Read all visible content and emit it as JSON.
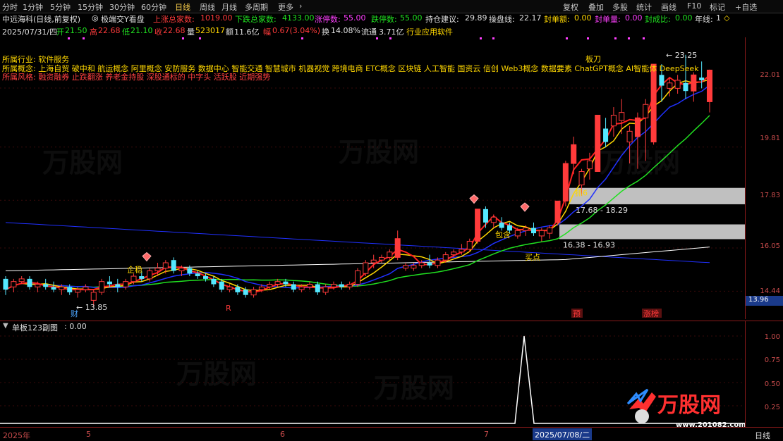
{
  "toolbar": {
    "periods": [
      "分时",
      "1分钟",
      "5分钟",
      "15分钟",
      "30分钟",
      "60分钟",
      "日线",
      "周线",
      "月线",
      "多周期",
      "更多"
    ],
    "active_period": "日线",
    "right_buttons": [
      "复权",
      "叠加",
      "多股",
      "统计",
      "画线",
      "F10",
      "标记",
      "+自选"
    ]
  },
  "info": {
    "stock_name": "中远海科(日线,前复权)",
    "panel_name": "极端交Y看盘",
    "up_total_label": "上涨总家数:",
    "up_total": "1019.00",
    "down_total_label": "下跌总家数:",
    "down_total": "4133.00",
    "limit_up_label": "涨停数:",
    "limit_up": "55.00",
    "limit_down_label": "跌停数:",
    "limit_down": "55.00",
    "position_label": "持仓建议:",
    "position": "29.89",
    "control_label": "操盘线:",
    "control": "22.17",
    "seal_amount_label": "封单额:",
    "seal_amount": "0.00",
    "seal_volume_label": "封单量:",
    "seal_volume": "0.00",
    "seal_ratio_label": "封成比:",
    "seal_ratio": "0.00",
    "year_line_label": "年线:",
    "year_line": "1"
  },
  "ohlc": {
    "date": "2025/07/31/四",
    "open_label": "开",
    "open": "21.50",
    "high_label": "高",
    "high": "22.68",
    "low_label": "低",
    "low": "21.10",
    "close_label": "收",
    "close": "22.68",
    "volume_label": "量",
    "volume": "523017",
    "amount_label": "额",
    "amount": "11.6亿",
    "change_label": "幅",
    "change": "0.67(3.04%)",
    "turnover_label": "换",
    "turnover": "14.08%",
    "float_label": "流通",
    "float": "3.71亿",
    "industry_tag": "行业应用软件"
  },
  "concepts": {
    "industry_label": "所属行业:",
    "industry": "软件服务",
    "concept_label": "所属概念:",
    "concept": "上海自贸 破中和 航运概念 阿里概念 安防服务 数据中心 智能交通 智慧城市 机器视觉 跨境电商 ETC概念 区块链 人工智能 国资云 信创 Web3概念 数据要素 ChatGPT概念 AI智能体 DeepSeek",
    "style_label": "所属风格:",
    "style": "融资融券 止跌翻涨 养老金持股 深股通标的 中字头 活跃股 近期强势"
  },
  "chart_data": {
    "type": "candlestick",
    "yticks": [
      "22.01",
      "19.81",
      "17.83",
      "16.05",
      "14.44"
    ],
    "ylim": [
      13.4,
      23.9
    ],
    "current_price_tag": "13.96",
    "candles": [
      {
        "o": 14.9,
        "h": 15.0,
        "l": 14.3,
        "c": 14.5
      },
      {
        "o": 14.6,
        "h": 14.9,
        "l": 14.4,
        "c": 14.8
      },
      {
        "o": 14.8,
        "h": 15.0,
        "l": 14.7,
        "c": 14.9
      },
      {
        "o": 14.9,
        "h": 15.0,
        "l": 14.5,
        "c": 14.6
      },
      {
        "o": 14.6,
        "h": 14.8,
        "l": 14.4,
        "c": 14.7
      },
      {
        "o": 14.7,
        "h": 14.9,
        "l": 14.5,
        "c": 14.6
      },
      {
        "o": 14.6,
        "h": 14.8,
        "l": 14.4,
        "c": 14.5
      },
      {
        "o": 14.5,
        "h": 14.7,
        "l": 14.3,
        "c": 14.6
      },
      {
        "o": 14.6,
        "h": 14.7,
        "l": 14.3,
        "c": 14.4
      },
      {
        "o": 14.4,
        "h": 14.6,
        "l": 14.2,
        "c": 14.5
      },
      {
        "o": 14.5,
        "h": 14.7,
        "l": 14.4,
        "c": 14.6
      },
      {
        "o": 14.1,
        "h": 14.5,
        "l": 13.85,
        "c": 14.4
      },
      {
        "o": 14.4,
        "h": 14.9,
        "l": 14.3,
        "c": 14.8
      },
      {
        "o": 14.8,
        "h": 15.0,
        "l": 14.6,
        "c": 14.7
      },
      {
        "o": 14.7,
        "h": 14.9,
        "l": 14.4,
        "c": 14.6
      },
      {
        "o": 14.6,
        "h": 14.9,
        "l": 14.5,
        "c": 14.8
      },
      {
        "o": 14.8,
        "h": 15.1,
        "l": 14.7,
        "c": 15.0
      },
      {
        "o": 15.0,
        "h": 15.2,
        "l": 14.8,
        "c": 14.9
      },
      {
        "o": 14.9,
        "h": 15.3,
        "l": 14.8,
        "c": 15.2
      },
      {
        "o": 15.2,
        "h": 15.5,
        "l": 15.0,
        "c": 15.3
      },
      {
        "o": 15.3,
        "h": 15.6,
        "l": 15.1,
        "c": 15.5
      },
      {
        "o": 15.6,
        "h": 15.7,
        "l": 15.1,
        "c": 15.2
      },
      {
        "o": 15.2,
        "h": 15.4,
        "l": 15.0,
        "c": 15.3
      },
      {
        "o": 15.3,
        "h": 15.4,
        "l": 15.0,
        "c": 15.1
      },
      {
        "o": 15.1,
        "h": 15.2,
        "l": 14.9,
        "c": 15.0
      },
      {
        "o": 15.0,
        "h": 15.1,
        "l": 14.8,
        "c": 14.9
      },
      {
        "o": 14.9,
        "h": 15.0,
        "l": 14.6,
        "c": 14.7
      },
      {
        "o": 14.8,
        "h": 14.9,
        "l": 14.4,
        "c": 14.5
      },
      {
        "o": 14.5,
        "h": 14.7,
        "l": 14.4,
        "c": 14.6
      },
      {
        "o": 14.6,
        "h": 14.7,
        "l": 14.3,
        "c": 14.4
      },
      {
        "o": 14.5,
        "h": 14.6,
        "l": 14.2,
        "c": 14.3
      },
      {
        "o": 14.3,
        "h": 14.6,
        "l": 14.2,
        "c": 14.5
      },
      {
        "o": 14.5,
        "h": 14.7,
        "l": 14.4,
        "c": 14.6
      },
      {
        "o": 14.6,
        "h": 14.8,
        "l": 14.5,
        "c": 14.7
      },
      {
        "o": 14.7,
        "h": 14.9,
        "l": 14.6,
        "c": 14.8
      },
      {
        "o": 14.8,
        "h": 14.9,
        "l": 14.6,
        "c": 14.7
      },
      {
        "o": 14.7,
        "h": 14.8,
        "l": 14.4,
        "c": 14.5
      },
      {
        "o": 14.5,
        "h": 14.7,
        "l": 14.4,
        "c": 14.6
      },
      {
        "o": 14.6,
        "h": 14.8,
        "l": 14.5,
        "c": 14.7
      },
      {
        "o": 14.7,
        "h": 14.8,
        "l": 14.3,
        "c": 14.4
      },
      {
        "o": 14.4,
        "h": 14.7,
        "l": 14.3,
        "c": 14.6
      },
      {
        "o": 14.6,
        "h": 14.8,
        "l": 14.5,
        "c": 14.7
      },
      {
        "o": 14.7,
        "h": 14.8,
        "l": 14.5,
        "c": 14.6
      },
      {
        "o": 14.6,
        "h": 14.8,
        "l": 14.5,
        "c": 14.7
      },
      {
        "o": 14.7,
        "h": 15.3,
        "l": 14.6,
        "c": 15.2
      },
      {
        "o": 15.1,
        "h": 15.6,
        "l": 15.0,
        "c": 15.5
      },
      {
        "o": 15.5,
        "h": 15.8,
        "l": 15.3,
        "c": 15.6
      },
      {
        "o": 15.6,
        "h": 15.8,
        "l": 15.5,
        "c": 15.7
      },
      {
        "o": 15.7,
        "h": 16.0,
        "l": 15.6,
        "c": 15.9
      },
      {
        "o": 15.7,
        "h": 16.7,
        "l": 15.6,
        "c": 16.4
      },
      {
        "o": 15.3,
        "h": 15.5,
        "l": 15.2,
        "c": 15.4
      },
      {
        "o": 15.3,
        "h": 15.5,
        "l": 15.2,
        "c": 15.4
      },
      {
        "o": 15.4,
        "h": 15.6,
        "l": 15.3,
        "c": 15.5
      },
      {
        "o": 15.5,
        "h": 15.8,
        "l": 15.3,
        "c": 15.4
      },
      {
        "o": 15.4,
        "h": 15.7,
        "l": 15.3,
        "c": 15.6
      },
      {
        "o": 15.6,
        "h": 15.9,
        "l": 15.5,
        "c": 15.8
      },
      {
        "o": 15.8,
        "h": 16.0,
        "l": 15.7,
        "c": 15.9
      },
      {
        "o": 15.9,
        "h": 16.2,
        "l": 15.8,
        "c": 16.0
      },
      {
        "o": 16.0,
        "h": 16.4,
        "l": 15.9,
        "c": 16.3
      },
      {
        "o": 16.3,
        "h": 17.5,
        "l": 16.2,
        "c": 17.5
      },
      {
        "o": 17.5,
        "h": 17.6,
        "l": 16.8,
        "c": 17.0
      },
      {
        "o": 17.0,
        "h": 17.3,
        "l": 16.8,
        "c": 17.2
      },
      {
        "o": 17.0,
        "h": 17.2,
        "l": 16.7,
        "c": 16.8
      },
      {
        "o": 16.9,
        "h": 17.0,
        "l": 16.6,
        "c": 16.7
      },
      {
        "o": 16.5,
        "h": 16.8,
        "l": 16.4,
        "c": 16.7
      },
      {
        "o": 16.7,
        "h": 16.9,
        "l": 16.5,
        "c": 16.8
      },
      {
        "o": 16.8,
        "h": 17.0,
        "l": 16.5,
        "c": 16.6
      },
      {
        "o": 16.5,
        "h": 16.8,
        "l": 16.3,
        "c": 16.7
      },
      {
        "o": 16.6,
        "h": 16.9,
        "l": 16.4,
        "c": 16.8
      },
      {
        "o": 17.0,
        "h": 17.8,
        "l": 16.9,
        "c": 17.8
      },
      {
        "o": 17.8,
        "h": 19.3,
        "l": 17.6,
        "c": 19.2
      },
      {
        "o": 19.2,
        "h": 20.2,
        "l": 18.8,
        "c": 19.9
      },
      {
        "o": 18.4,
        "h": 19.0,
        "l": 18.0,
        "c": 18.9
      },
      {
        "o": 19.0,
        "h": 19.6,
        "l": 18.6,
        "c": 19.3
      },
      {
        "o": 18.9,
        "h": 21.0,
        "l": 18.9,
        "c": 21.0
      },
      {
        "o": 20.5,
        "h": 20.9,
        "l": 19.8,
        "c": 20.0
      },
      {
        "o": 20.6,
        "h": 21.3,
        "l": 20.2,
        "c": 21.0
      },
      {
        "o": 20.8,
        "h": 21.6,
        "l": 20.3,
        "c": 21.1
      },
      {
        "o": 20.0,
        "h": 20.6,
        "l": 19.2,
        "c": 20.4
      },
      {
        "o": 20.2,
        "h": 21.1,
        "l": 19.0,
        "c": 20.9
      },
      {
        "o": 20.9,
        "h": 21.6,
        "l": 19.3,
        "c": 21.4
      },
      {
        "o": 20.0,
        "h": 22.9,
        "l": 19.9,
        "c": 22.9
      },
      {
        "o": 22.5,
        "h": 22.9,
        "l": 21.5,
        "c": 22.1
      },
      {
        "o": 22.0,
        "h": 22.4,
        "l": 21.7,
        "c": 22.2
      },
      {
        "o": 22.0,
        "h": 22.5,
        "l": 21.8,
        "c": 22.3
      },
      {
        "o": 22.2,
        "h": 23.25,
        "l": 21.6,
        "c": 21.9
      },
      {
        "o": 21.9,
        "h": 22.6,
        "l": 21.5,
        "c": 22.5
      },
      {
        "o": 22.4,
        "h": 23.0,
        "l": 22.0,
        "c": 22.3
      },
      {
        "o": 21.5,
        "h": 22.7,
        "l": 21.1,
        "c": 22.68
      }
    ],
    "annotations": [
      {
        "text": "13.85",
        "kind": "low"
      },
      {
        "text": "23.25",
        "kind": "high"
      },
      {
        "text": "企稳",
        "kind": "signal"
      },
      {
        "text": "包含",
        "kind": "signal"
      },
      {
        "text": "买点",
        "kind": "signal"
      },
      {
        "text": "抓6",
        "kind": "signal"
      },
      {
        "text": "板刀",
        "kind": "signal"
      },
      {
        "text": "17.68 - 18.29",
        "kind": "zone"
      },
      {
        "text": "16.38 - 16.93",
        "kind": "zone"
      },
      {
        "text": "财",
        "kind": "event"
      },
      {
        "text": "R",
        "kind": "event"
      },
      {
        "text": "预",
        "kind": "event"
      },
      {
        "text": "涨榜",
        "kind": "event"
      }
    ]
  },
  "sub": {
    "title": "单板123副图",
    "value": ": 0.00",
    "yticks": [
      "1.00",
      "0.75",
      "0.50",
      "0.25"
    ]
  },
  "dates": {
    "labels": [
      "2025年",
      "5",
      "6",
      "7"
    ],
    "cursor": "2025/07/08/二",
    "period": "日线"
  },
  "watermark": {
    "brand": "万股网",
    "url": "www.201082.com",
    "logo_text": "万股网"
  },
  "colors": {
    "up": "#ff3b3b",
    "down": "#54e8ff",
    "ma_white": "#ffffff",
    "ma_yellow": "#ffd700",
    "ma_red": "#ff2020",
    "ma_blue": "#2030ff",
    "ma_green": "#20e020"
  }
}
